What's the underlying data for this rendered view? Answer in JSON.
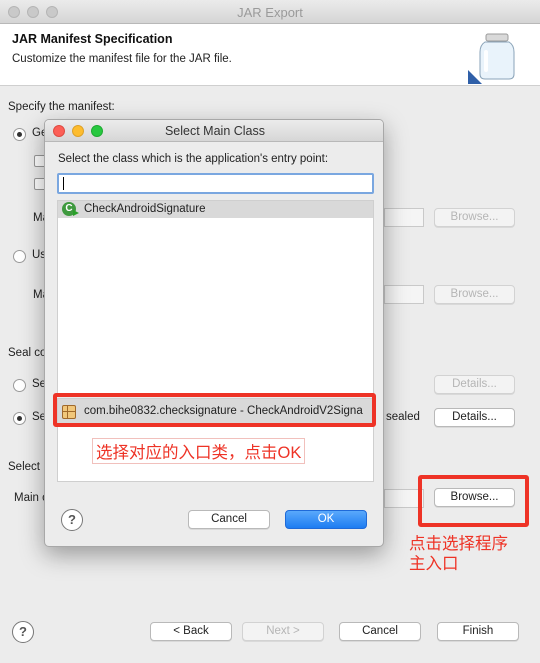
{
  "window": {
    "title": "JAR Export"
  },
  "banner": {
    "title": "JAR Manifest Specification",
    "description": "Customize the manifest file for the JAR file."
  },
  "manifest": {
    "heading": "Specify the manifest:",
    "generate_label": "Ge",
    "main_label_1": "Ma",
    "use_existing_label": "Us",
    "main_label_2": "Ma",
    "browse_1": "Browse...",
    "browse_2": "Browse..."
  },
  "seal": {
    "heading": "Seal co",
    "option1_label": "Se",
    "option2_label": "Se",
    "sealed_suffix": "sealed",
    "details_1": "Details...",
    "details_2": "Details..."
  },
  "select": {
    "heading": "Select",
    "main_label": "Main c",
    "browse": "Browse..."
  },
  "footer": {
    "help": "?",
    "back": "< Back",
    "next": "Next >",
    "cancel": "Cancel",
    "finish": "Finish"
  },
  "dialog": {
    "title": "Select Main Class",
    "prompt": "Select the class which is the application's entry point:",
    "search_value": "",
    "class_item": "CheckAndroidSignature",
    "class_icon": "class-run-icon",
    "qualifier": "com.bihe0832.checksignature - CheckAndroidV2Signa",
    "qualifier_icon": "package-icon",
    "help": "?",
    "cancel": "Cancel",
    "ok": "OK"
  },
  "annotations": {
    "dialog_note": "选择对应的入口类，点击OK",
    "browse_note_line1": "点击选择程序",
    "browse_note_line2": "主入口",
    "color": "#ee3326"
  }
}
